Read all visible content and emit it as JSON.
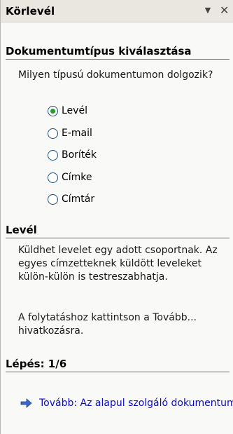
{
  "pane": {
    "title": "Körlevél",
    "dropdown_icon": "▼",
    "close_icon": "✕"
  },
  "doc_type": {
    "heading": "Dokumentumtípus kiválasztása",
    "question": "Milyen típusú dokumentumon dolgozik?",
    "options": [
      {
        "label": "Levél",
        "selected": true
      },
      {
        "label": "E-mail",
        "selected": false
      },
      {
        "label": "Boríték",
        "selected": false
      },
      {
        "label": "Címke",
        "selected": false
      },
      {
        "label": "Címtár",
        "selected": false
      }
    ]
  },
  "description": {
    "heading": "Levél",
    "paragraph1": "Küldhet levelet egy adott csoportnak. Az egyes címzetteknek küldött leveleket külön-külön is testreszabhatja.",
    "paragraph2": "A folytatáshoz kattintson a Tovább... hivatkozásra."
  },
  "step": {
    "heading": "Lépés: 1/6",
    "next_link": "Tovább: Az alapul szolgáló dokumentum"
  },
  "colors": {
    "radio_selected": "#21a121",
    "link": "#0a0ac8",
    "arrow": "#3a68c8"
  }
}
